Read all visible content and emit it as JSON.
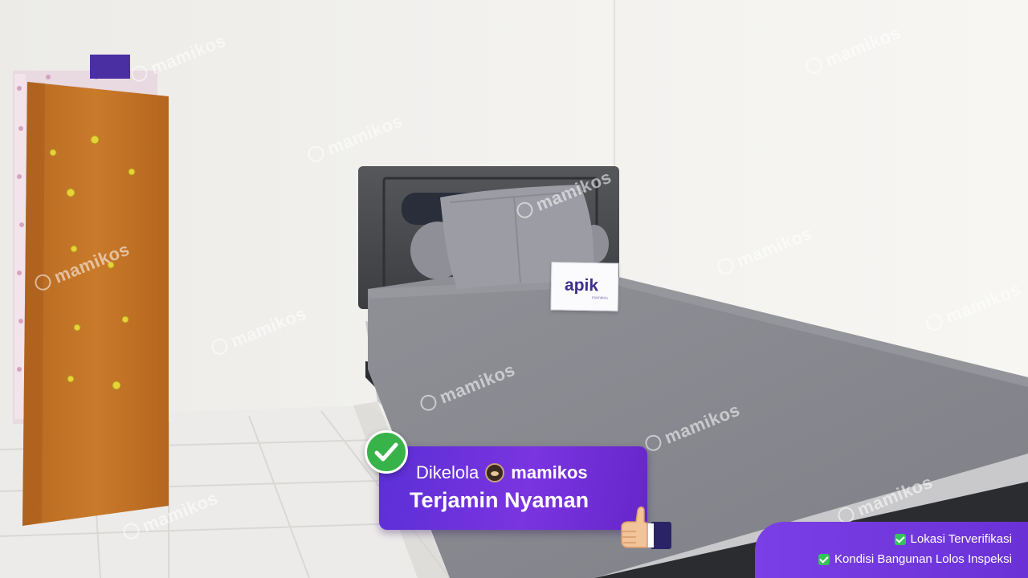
{
  "photo": {
    "subject": "kos-room",
    "watermark_text": "mamikos"
  },
  "card": {
    "logo_text": "apik",
    "sub_text": "mamikos"
  },
  "banner": {
    "managed_label": "Dikelola",
    "brand": "mamikos",
    "tagline": "Terjamin Nyaman"
  },
  "verification": {
    "items": [
      {
        "label": "Lokasi Terverifikasi"
      },
      {
        "label": "Kondisi Bangunan Lolos Inspeksi"
      }
    ]
  },
  "colors": {
    "brand_purple": "#6a32d6",
    "check_green": "#38b349"
  }
}
